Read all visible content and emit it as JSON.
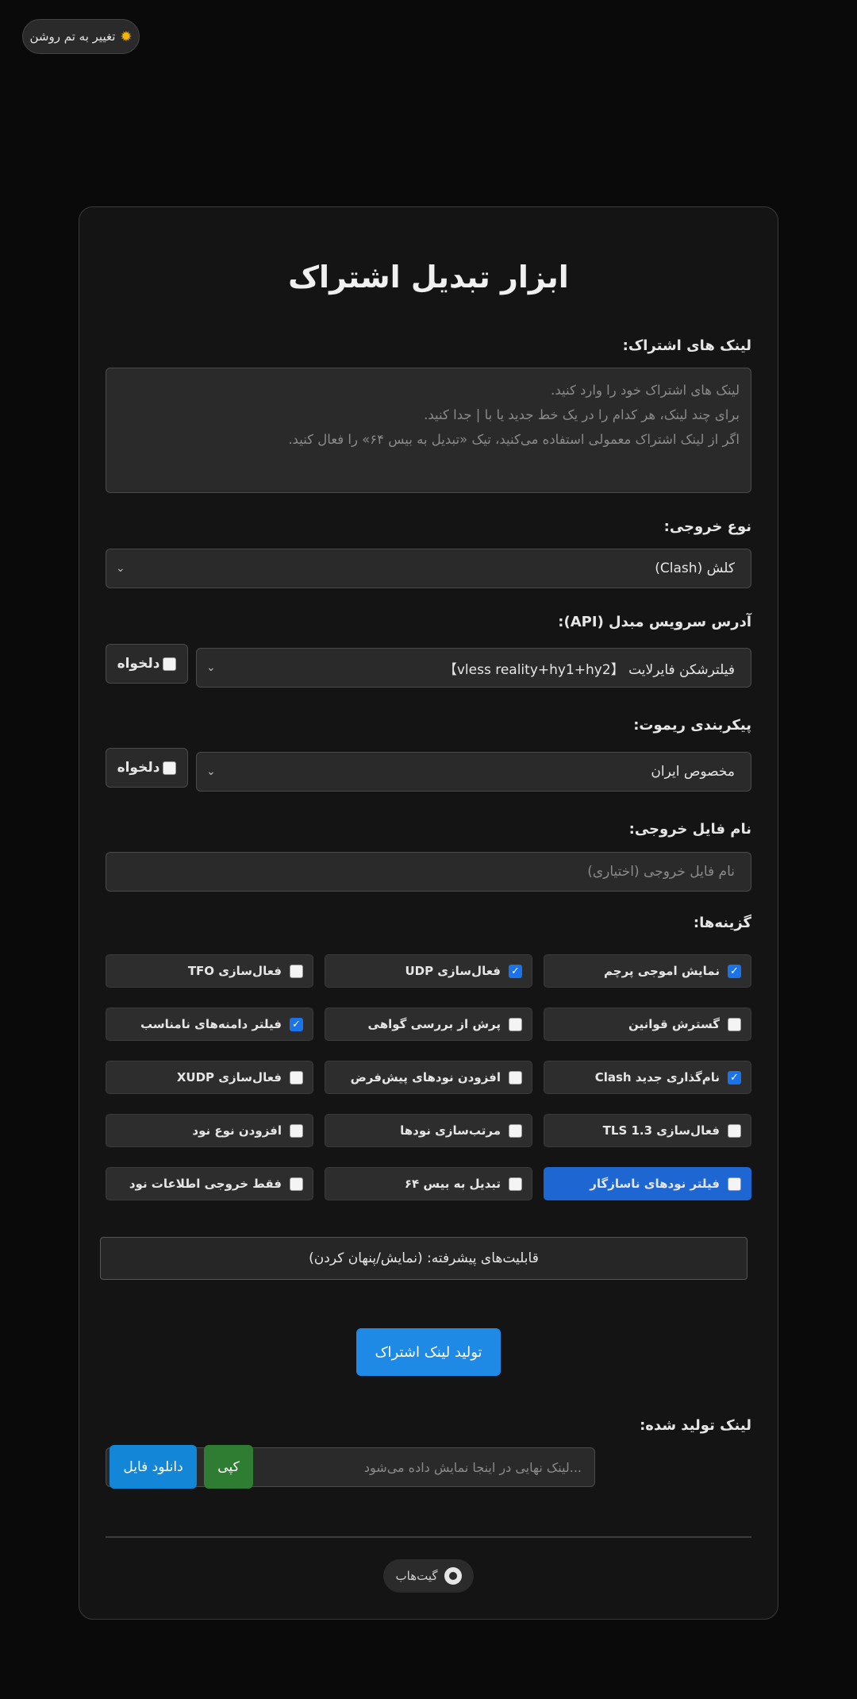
{
  "theme_toggle": {
    "label": "تغییر به تم روشن",
    "icon": "sun-icon"
  },
  "title": "ابزار تبدیل اشتراک",
  "subscription": {
    "label": "لینک های اشتراک:",
    "placeholder_lines": [
      "لینک های اشتراک خود را وارد کنید.",
      "برای چند لینک، هر کدام را در یک خط جدید یا با | جدا کنید.",
      "اگر از لینک اشتراک معمولی استفاده می‌کنید، تیک «تبدیل به بیس ۶۴» را فعال کنید."
    ]
  },
  "output_type": {
    "label": "نوع خروجی:",
    "value": "کلش (Clash)"
  },
  "api": {
    "label": "آدرس سرویس مبدل (API):",
    "value": "فیلترشکن فایرلایت 【vless reality+hy1+hy2】",
    "custom_label": "دلخواه"
  },
  "remote": {
    "label": "پیکربندی ریموت:",
    "value": "مخصوص ایران",
    "custom_label": "دلخواه"
  },
  "filename": {
    "label": "نام فایل خروجی:",
    "placeholder": "نام فایل خروجی (اختیاری)"
  },
  "options": {
    "label": "گزینه‌ها:",
    "items": [
      {
        "label": "نمایش اموجی پرچم",
        "checked": true
      },
      {
        "label": "فعال‌سازی UDP",
        "checked": true
      },
      {
        "label": "فعال‌سازی TFO",
        "checked": false
      },
      {
        "label": "گسترش قوانین",
        "checked": false
      },
      {
        "label": "پرش از بررسی گواهی",
        "checked": false
      },
      {
        "label": "فیلتر دامنه‌های نامناسب",
        "checked": true
      },
      {
        "label": "نام‌گذاری جدید Clash",
        "checked": true
      },
      {
        "label": "افزودن نودهای پیش‌فرض",
        "checked": false
      },
      {
        "label": "فعال‌سازی XUDP",
        "checked": false
      },
      {
        "label": "فعال‌سازی TLS 1.3",
        "checked": false
      },
      {
        "label": "مرتب‌سازی نودها",
        "checked": false
      },
      {
        "label": "افزودن نوع نود",
        "checked": false
      },
      {
        "label": "فیلتر نودهای ناسازگار",
        "checked": false
      },
      {
        "label": "تبدیل به بیس ۶۴",
        "checked": false
      },
      {
        "label": "فقط خروجی اطلاعات نود",
        "checked": false
      }
    ]
  },
  "advanced_toggle": "قابلیت‌های پیشرفته: (نمایش/پنهان کردن)",
  "generate_button": "تولید لینک اشتراک",
  "generated": {
    "label": "لینک تولید شده:",
    "placeholder": "...لینک نهایی در اینجا نمایش داده می‌شود",
    "copy_button": "کپی",
    "download_button": "دانلود فایل"
  },
  "footer": {
    "github_label": "گیت‌هاب"
  },
  "colors": {
    "accent": "#1e8ae6",
    "copy": "#2e7d32",
    "highlight": "#1e67d2"
  }
}
